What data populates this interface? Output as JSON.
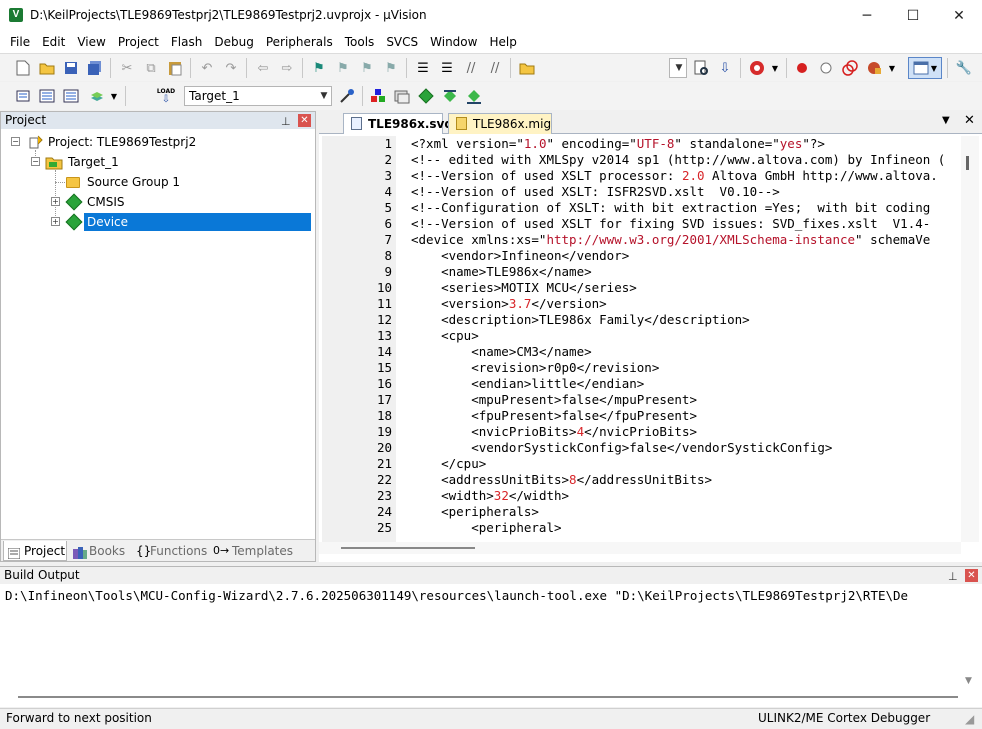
{
  "window": {
    "title": "D:\\KeilProjects\\TLE9869Testprj2\\TLE9869Testprj2.uvprojx - µVision",
    "icon_letter": "V",
    "minimize": "─",
    "maximize": "☐",
    "close": "✕"
  },
  "menu": [
    "File",
    "Edit",
    "View",
    "Project",
    "Flash",
    "Debug",
    "Peripherals",
    "Tools",
    "SVCS",
    "Window",
    "Help"
  ],
  "toolbar2": {
    "target_combo": "Target_1",
    "load_label": "LOAD"
  },
  "project_panel": {
    "title": "Project",
    "tree": {
      "project": "Project: TLE9869Testprj2",
      "target": "Target_1",
      "source_group": "Source Group 1",
      "cmsis": "CMSIS",
      "device": "Device"
    },
    "tabs": [
      "Project",
      "Books",
      "Functions",
      "Templates"
    ],
    "tab_icons": [
      "",
      "",
      "{}",
      "0→"
    ]
  },
  "editor": {
    "tabs": [
      "TLE986x.svd",
      "TLE986x.mig"
    ],
    "line_numbers": [
      "1",
      "2",
      "3",
      "4",
      "5",
      "6",
      "7",
      "8",
      "9",
      "10",
      "11",
      "12",
      "13",
      "14",
      "15",
      "16",
      "17",
      "18",
      "19",
      "20",
      "21",
      "22",
      "23",
      "24",
      "25"
    ],
    "lines": [
      "<?xml version=\"1.0\" encoding=\"UTF-8\" standalone=\"yes\"?>",
      "<!-- edited with XMLSpy v2014 sp1 (http://www.altova.com) by Infineon (",
      "<!--Version of used XSLT processor: 2.0 Altova GmbH http://www.altova.",
      "<!--Version of used XSLT: ISFR2SVD.xslt  V0.10-->",
      "<!--Configuration of XSLT: with bit extraction =Yes;  with bit coding",
      "<!--Version of used XSLT for fixing SVD issues: SVD_fixes.xslt  V1.4-",
      "<device xmlns:xs=\"http://www.w3.org/2001/XMLSchema-instance\" schemaVe",
      "    <vendor>Infineon</vendor>",
      "    <name>TLE986x</name>",
      "    <series>MOTIX MCU</series>",
      "    <version>3.7</version>",
      "    <description>TLE986x Family</description>",
      "    <cpu>",
      "        <name>CM3</name>",
      "        <revision>r0p0</revision>",
      "        <endian>little</endian>",
      "        <mpuPresent>false</mpuPresent>",
      "        <fpuPresent>false</fpuPresent>",
      "        <nvicPrioBits>4</nvicPrioBits>",
      "        <vendorSystickConfig>false</vendorSystickConfig>",
      "    </cpu>",
      "    <addressUnitBits>8</addressUnitBits>",
      "    <width>32</width>",
      "    <peripherals>",
      "        <peripheral>"
    ]
  },
  "build_output": {
    "title": "Build Output",
    "text": "D:\\Infineon\\Tools\\MCU-Config-Wizard\\2.7.6.202506301149\\resources\\launch-tool.exe \"D:\\KeilProjects\\TLE9869Testprj2\\RTE\\De"
  },
  "statusbar": {
    "left": "Forward to next position",
    "right": "ULINK2/ME Cortex Debugger"
  },
  "colors": {
    "selection": "#0a78d7",
    "string": "#b5122a",
    "panel_header": "#dfe6ee"
  }
}
